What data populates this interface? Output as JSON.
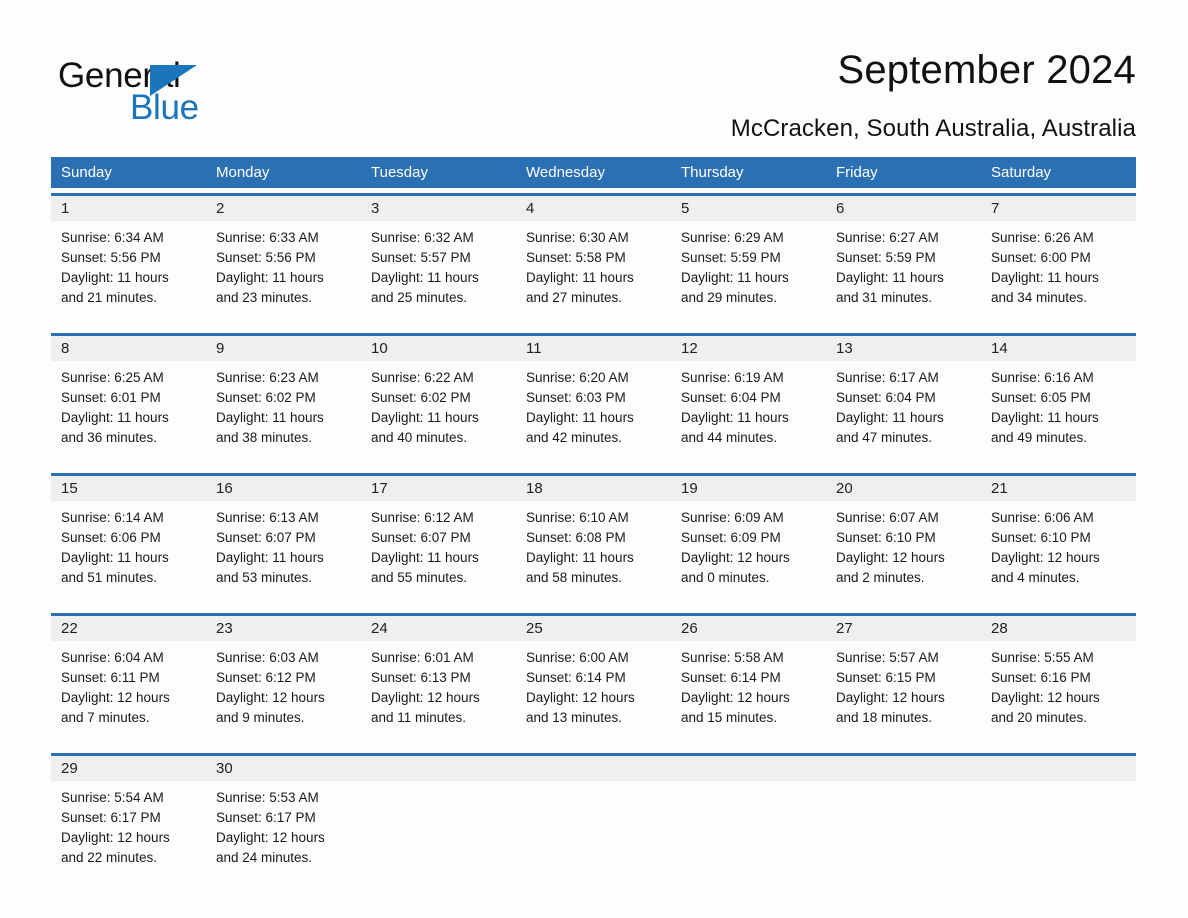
{
  "brand": {
    "name_part1": "General",
    "name_part2": "Blue",
    "accent_color": "#1b75bb"
  },
  "header": {
    "title": "September 2024",
    "subtitle": "McCracken, South Australia, Australia"
  },
  "theme": {
    "header_blue": "#2b70b3",
    "daynum_band": "#efefef",
    "page_background": "#fdfdfd"
  },
  "calendar": {
    "weekday_headers": [
      "Sunday",
      "Monday",
      "Tuesday",
      "Wednesday",
      "Thursday",
      "Friday",
      "Saturday"
    ],
    "weeks": [
      {
        "daynums": [
          "1",
          "2",
          "3",
          "4",
          "5",
          "6",
          "7"
        ],
        "cells": [
          {
            "sunrise": "Sunrise: 6:34 AM",
            "sunset": "Sunset: 5:56 PM",
            "daylight1": "Daylight: 11 hours",
            "daylight2": "and 21 minutes."
          },
          {
            "sunrise": "Sunrise: 6:33 AM",
            "sunset": "Sunset: 5:56 PM",
            "daylight1": "Daylight: 11 hours",
            "daylight2": "and 23 minutes."
          },
          {
            "sunrise": "Sunrise: 6:32 AM",
            "sunset": "Sunset: 5:57 PM",
            "daylight1": "Daylight: 11 hours",
            "daylight2": "and 25 minutes."
          },
          {
            "sunrise": "Sunrise: 6:30 AM",
            "sunset": "Sunset: 5:58 PM",
            "daylight1": "Daylight: 11 hours",
            "daylight2": "and 27 minutes."
          },
          {
            "sunrise": "Sunrise: 6:29 AM",
            "sunset": "Sunset: 5:59 PM",
            "daylight1": "Daylight: 11 hours",
            "daylight2": "and 29 minutes."
          },
          {
            "sunrise": "Sunrise: 6:27 AM",
            "sunset": "Sunset: 5:59 PM",
            "daylight1": "Daylight: 11 hours",
            "daylight2": "and 31 minutes."
          },
          {
            "sunrise": "Sunrise: 6:26 AM",
            "sunset": "Sunset: 6:00 PM",
            "daylight1": "Daylight: 11 hours",
            "daylight2": "and 34 minutes."
          }
        ]
      },
      {
        "daynums": [
          "8",
          "9",
          "10",
          "11",
          "12",
          "13",
          "14"
        ],
        "cells": [
          {
            "sunrise": "Sunrise: 6:25 AM",
            "sunset": "Sunset: 6:01 PM",
            "daylight1": "Daylight: 11 hours",
            "daylight2": "and 36 minutes."
          },
          {
            "sunrise": "Sunrise: 6:23 AM",
            "sunset": "Sunset: 6:02 PM",
            "daylight1": "Daylight: 11 hours",
            "daylight2": "and 38 minutes."
          },
          {
            "sunrise": "Sunrise: 6:22 AM",
            "sunset": "Sunset: 6:02 PM",
            "daylight1": "Daylight: 11 hours",
            "daylight2": "and 40 minutes."
          },
          {
            "sunrise": "Sunrise: 6:20 AM",
            "sunset": "Sunset: 6:03 PM",
            "daylight1": "Daylight: 11 hours",
            "daylight2": "and 42 minutes."
          },
          {
            "sunrise": "Sunrise: 6:19 AM",
            "sunset": "Sunset: 6:04 PM",
            "daylight1": "Daylight: 11 hours",
            "daylight2": "and 44 minutes."
          },
          {
            "sunrise": "Sunrise: 6:17 AM",
            "sunset": "Sunset: 6:04 PM",
            "daylight1": "Daylight: 11 hours",
            "daylight2": "and 47 minutes."
          },
          {
            "sunrise": "Sunrise: 6:16 AM",
            "sunset": "Sunset: 6:05 PM",
            "daylight1": "Daylight: 11 hours",
            "daylight2": "and 49 minutes."
          }
        ]
      },
      {
        "daynums": [
          "15",
          "16",
          "17",
          "18",
          "19",
          "20",
          "21"
        ],
        "cells": [
          {
            "sunrise": "Sunrise: 6:14 AM",
            "sunset": "Sunset: 6:06 PM",
            "daylight1": "Daylight: 11 hours",
            "daylight2": "and 51 minutes."
          },
          {
            "sunrise": "Sunrise: 6:13 AM",
            "sunset": "Sunset: 6:07 PM",
            "daylight1": "Daylight: 11 hours",
            "daylight2": "and 53 minutes."
          },
          {
            "sunrise": "Sunrise: 6:12 AM",
            "sunset": "Sunset: 6:07 PM",
            "daylight1": "Daylight: 11 hours",
            "daylight2": "and 55 minutes."
          },
          {
            "sunrise": "Sunrise: 6:10 AM",
            "sunset": "Sunset: 6:08 PM",
            "daylight1": "Daylight: 11 hours",
            "daylight2": "and 58 minutes."
          },
          {
            "sunrise": "Sunrise: 6:09 AM",
            "sunset": "Sunset: 6:09 PM",
            "daylight1": "Daylight: 12 hours",
            "daylight2": "and 0 minutes."
          },
          {
            "sunrise": "Sunrise: 6:07 AM",
            "sunset": "Sunset: 6:10 PM",
            "daylight1": "Daylight: 12 hours",
            "daylight2": "and 2 minutes."
          },
          {
            "sunrise": "Sunrise: 6:06 AM",
            "sunset": "Sunset: 6:10 PM",
            "daylight1": "Daylight: 12 hours",
            "daylight2": "and 4 minutes."
          }
        ]
      },
      {
        "daynums": [
          "22",
          "23",
          "24",
          "25",
          "26",
          "27",
          "28"
        ],
        "cells": [
          {
            "sunrise": "Sunrise: 6:04 AM",
            "sunset": "Sunset: 6:11 PM",
            "daylight1": "Daylight: 12 hours",
            "daylight2": "and 7 minutes."
          },
          {
            "sunrise": "Sunrise: 6:03 AM",
            "sunset": "Sunset: 6:12 PM",
            "daylight1": "Daylight: 12 hours",
            "daylight2": "and 9 minutes."
          },
          {
            "sunrise": "Sunrise: 6:01 AM",
            "sunset": "Sunset: 6:13 PM",
            "daylight1": "Daylight: 12 hours",
            "daylight2": "and 11 minutes."
          },
          {
            "sunrise": "Sunrise: 6:00 AM",
            "sunset": "Sunset: 6:14 PM",
            "daylight1": "Daylight: 12 hours",
            "daylight2": "and 13 minutes."
          },
          {
            "sunrise": "Sunrise: 5:58 AM",
            "sunset": "Sunset: 6:14 PM",
            "daylight1": "Daylight: 12 hours",
            "daylight2": "and 15 minutes."
          },
          {
            "sunrise": "Sunrise: 5:57 AM",
            "sunset": "Sunset: 6:15 PM",
            "daylight1": "Daylight: 12 hours",
            "daylight2": "and 18 minutes."
          },
          {
            "sunrise": "Sunrise: 5:55 AM",
            "sunset": "Sunset: 6:16 PM",
            "daylight1": "Daylight: 12 hours",
            "daylight2": "and 20 minutes."
          }
        ]
      },
      {
        "daynums": [
          "29",
          "30",
          "",
          "",
          "",
          "",
          ""
        ],
        "cells": [
          {
            "sunrise": "Sunrise: 5:54 AM",
            "sunset": "Sunset: 6:17 PM",
            "daylight1": "Daylight: 12 hours",
            "daylight2": "and 22 minutes."
          },
          {
            "sunrise": "Sunrise: 5:53 AM",
            "sunset": "Sunset: 6:17 PM",
            "daylight1": "Daylight: 12 hours",
            "daylight2": "and 24 minutes."
          },
          {
            "sunrise": "",
            "sunset": "",
            "daylight1": "",
            "daylight2": ""
          },
          {
            "sunrise": "",
            "sunset": "",
            "daylight1": "",
            "daylight2": ""
          },
          {
            "sunrise": "",
            "sunset": "",
            "daylight1": "",
            "daylight2": ""
          },
          {
            "sunrise": "",
            "sunset": "",
            "daylight1": "",
            "daylight2": ""
          },
          {
            "sunrise": "",
            "sunset": "",
            "daylight1": "",
            "daylight2": ""
          }
        ]
      }
    ]
  }
}
